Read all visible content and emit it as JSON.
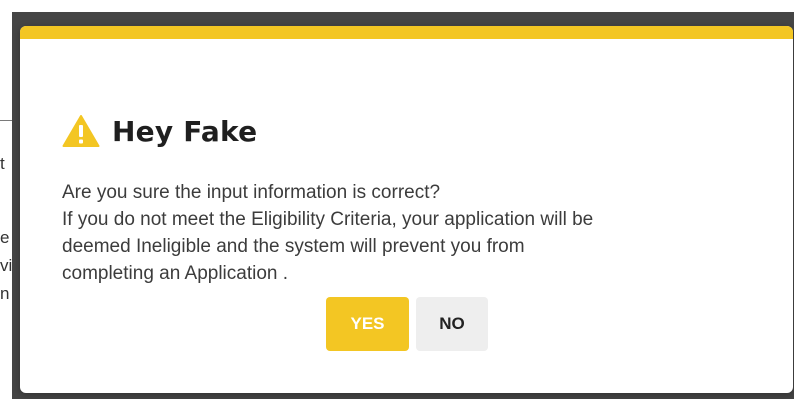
{
  "dialog": {
    "icon": "warning-icon",
    "title": "Hey Fake",
    "lines": [
      "Are you sure the input information is correct?",
      "If you do not meet the Eligibility Criteria, your application will be",
      "deemed Ineligible and the system will prevent you from",
      "completing an Application ."
    ],
    "yes_label": "YES",
    "no_label": "NO"
  },
  "background": {
    "fragments": [
      "t",
      "e",
      "vi",
      "n"
    ]
  },
  "colors": {
    "accent": "#f3c623",
    "overlay": "#454545",
    "no_button": "#eeeeee"
  }
}
